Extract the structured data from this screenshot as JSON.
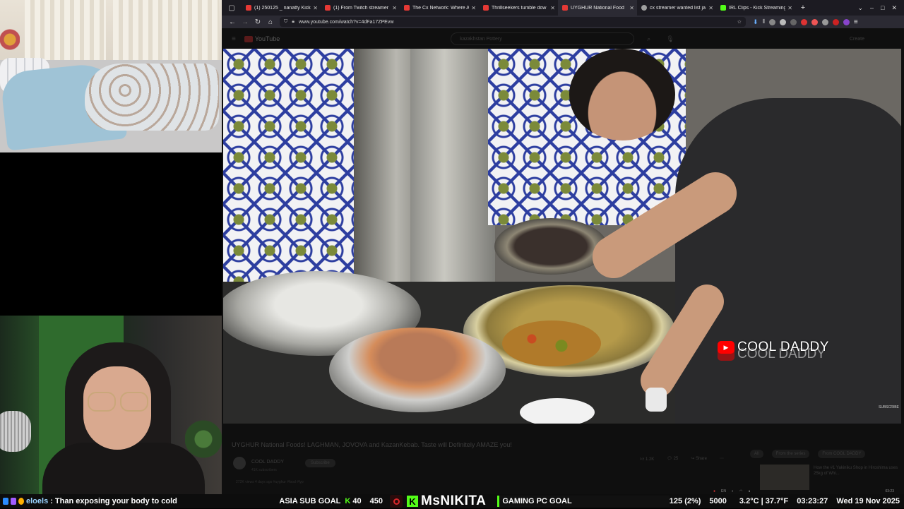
{
  "browser": {
    "tabs": [
      {
        "title": "(1) 250125 _ nanatty Kick V",
        "color": "#e53935"
      },
      {
        "title": "(1) From Twitch streamer t",
        "color": "#e53935"
      },
      {
        "title": "The Cx Network: Where A",
        "color": "#e53935"
      },
      {
        "title": "Thrillseekers tumble dow",
        "color": "#e53935"
      },
      {
        "title": "UYGHUR National Food",
        "color": "#e53935"
      },
      {
        "title": "cx streamer wanted list ja",
        "color": "#9e9e9e"
      },
      {
        "title": "IRL Clips - Kick Streaming",
        "color": "#53fc18"
      }
    ],
    "new_tab": "+",
    "url": "www.youtube.com/watch?v=4dFa17ZPEvw"
  },
  "youtube": {
    "logo": "YouTube",
    "search": "kazakhstan Pottery",
    "create": "Create",
    "watermark": "COOL DADDY",
    "subscribe_mark": "SUBSCRIBE",
    "video_title": "UYGHUR National Foods! LAGHMAN, JOVOVA and KazanKebab. Taste will Definitely AMAZE you!",
    "channel_name": "COOL DADDY",
    "subscribers": "41K subscribers",
    "subscribe": "Subscribe",
    "likes": "1.2K",
    "comments": "25",
    "share": "Share",
    "meta": "272K views  4 days ago  #uyghur #food #fyp",
    "related_tabs": [
      "All",
      "From the series",
      "From COOL DADDY"
    ],
    "related_title": "How the #1 Yakiniku Shop in Hiroshima uses 25kg of Whi..."
  },
  "taskbar": {
    "lang": "EN",
    "time": "03:23"
  },
  "stream": {
    "chat_user": "eloels",
    "chat_msg": ": Than exposing your body to cold",
    "sub_goal_label": "ASIA SUB GOAL",
    "sub_goal_k": "K",
    "sub_goal_current": "40",
    "sub_goal_target": "450",
    "kick_logo": "K",
    "streamer": "MsNIKITA",
    "pc_goal": "GAMING PC GOAL",
    "pc_progress": "125 (2%)",
    "pc_target": "5000",
    "weather": "3.2°C | 37.7°F",
    "clock": "03:23:27",
    "date": "Wed 19 Nov 2025"
  },
  "colors": {
    "kick_green": "#53fc18",
    "yt_red": "#ff0000",
    "chat_user": "#9ad3ff"
  }
}
